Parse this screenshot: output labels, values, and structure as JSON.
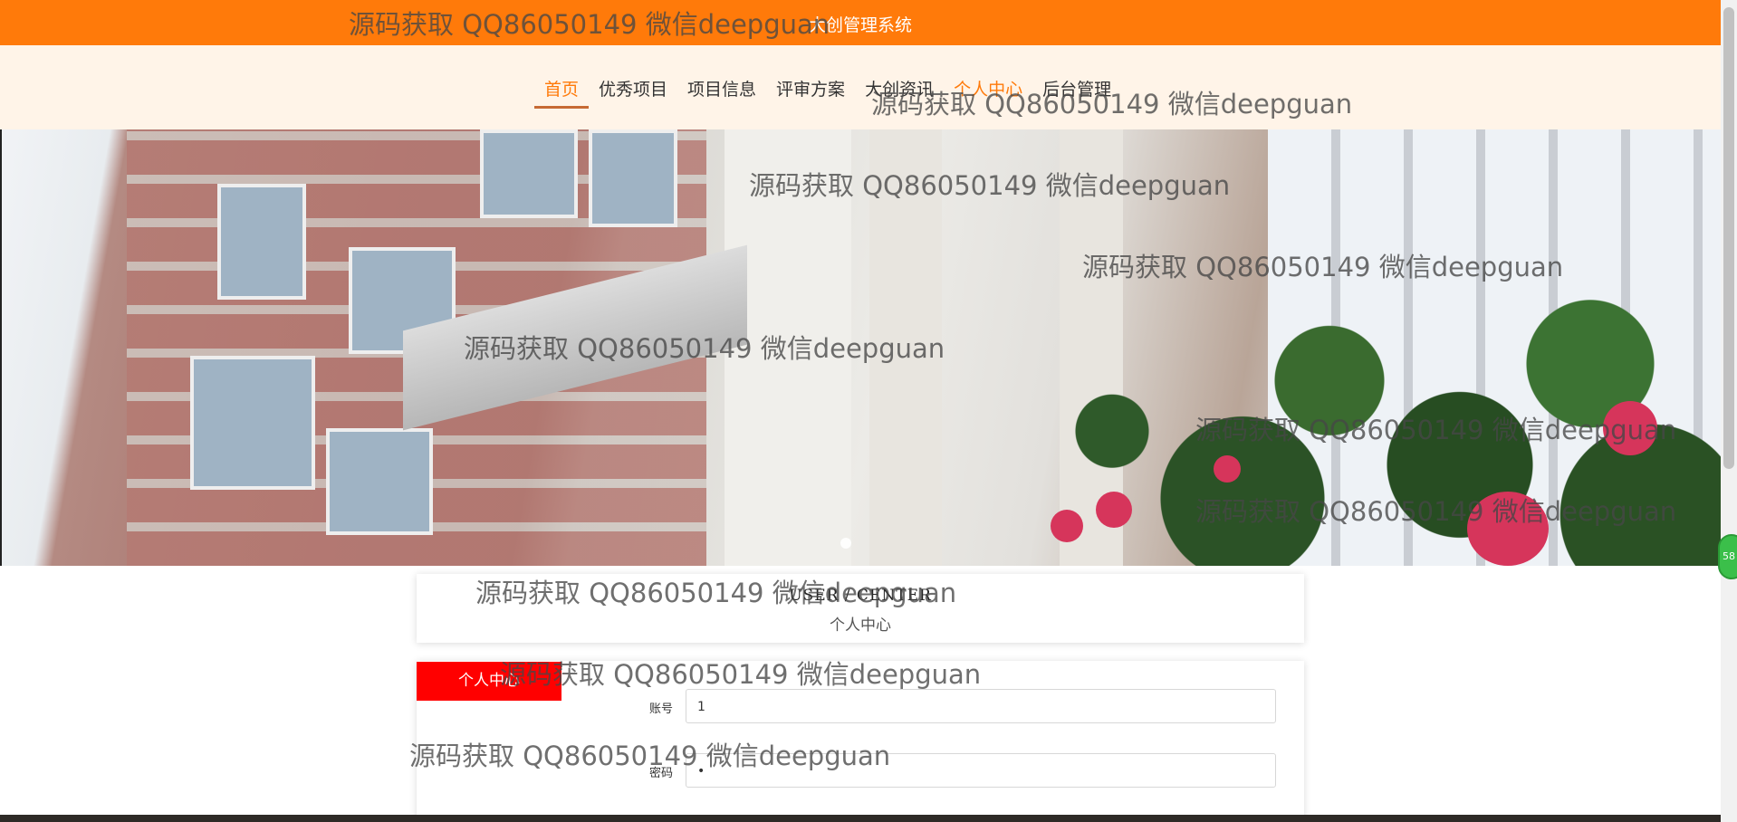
{
  "site": {
    "title": "大创管理系统"
  },
  "nav": {
    "items": [
      {
        "label": "首页",
        "state": "active"
      },
      {
        "label": "优秀项目",
        "state": ""
      },
      {
        "label": "项目信息",
        "state": ""
      },
      {
        "label": "评审方案",
        "state": ""
      },
      {
        "label": "大创资讯",
        "state": ""
      },
      {
        "label": "个人中心",
        "state": "highlight"
      },
      {
        "label": "后台管理",
        "state": ""
      }
    ]
  },
  "colors": {
    "accent": "#ff7a0a",
    "nav_bg": "#fff4e8",
    "side_button": "#ff0000"
  },
  "user_center": {
    "title_en": "USER / CENTER",
    "title_cn": "个人中心",
    "side_button_label": "个人中心",
    "fields": {
      "account": {
        "label": "账号",
        "value": "1"
      },
      "password": {
        "label": "密码",
        "value": "•"
      }
    }
  },
  "floating_badge": {
    "text": "58"
  },
  "watermark": {
    "text": "源码获取 QQ86050149 微信deepguan"
  }
}
